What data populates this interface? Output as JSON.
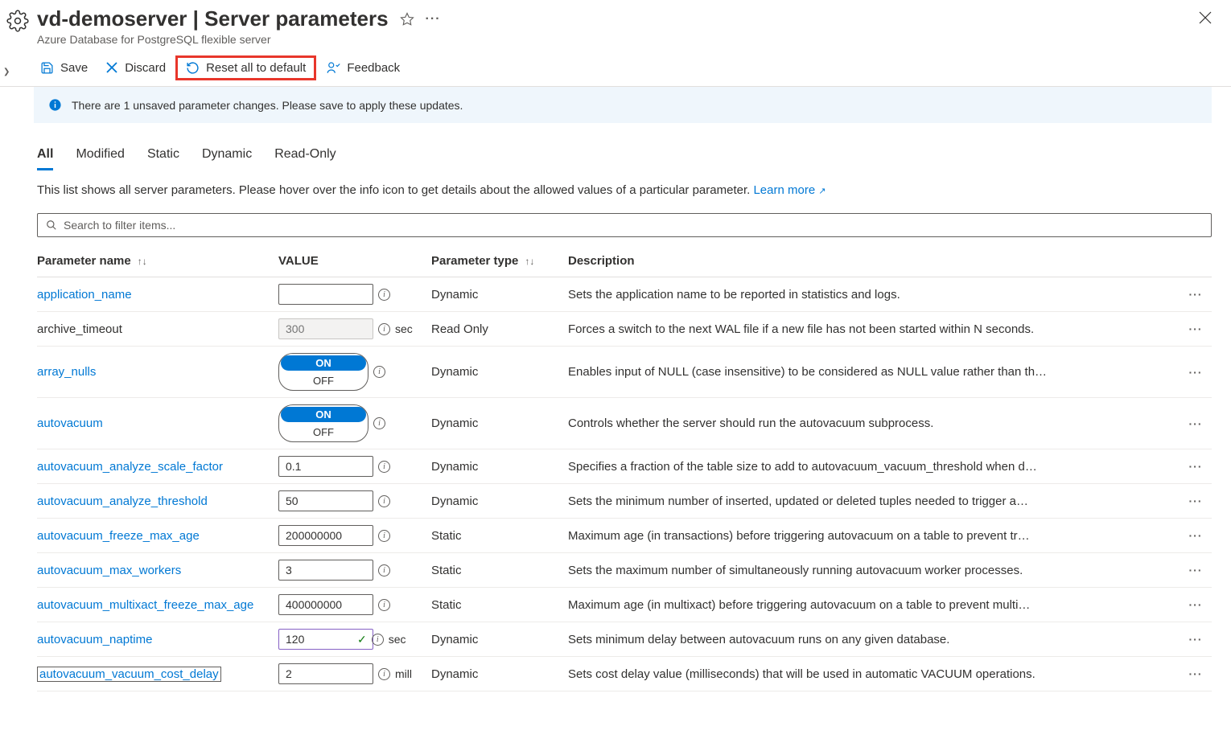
{
  "header": {
    "resource_name": "vd-demoserver",
    "page_title": "Server parameters",
    "breadcrumb": "Azure Database for PostgreSQL flexible server"
  },
  "toolbar": {
    "save": "Save",
    "discard": "Discard",
    "reset": "Reset all to default",
    "feedback": "Feedback"
  },
  "banner": {
    "text": "There are 1 unsaved parameter changes.  Please save to apply these updates."
  },
  "tabs": [
    "All",
    "Modified",
    "Static",
    "Dynamic",
    "Read-Only"
  ],
  "active_tab": 0,
  "description": {
    "text": "This list shows all server parameters. Please hover over the info icon to get details about the allowed values of a particular parameter. ",
    "link": "Learn more"
  },
  "search": {
    "placeholder": "Search to filter items..."
  },
  "columns": {
    "name": "Parameter name",
    "value": "VALUE",
    "type": "Parameter type",
    "desc": "Description"
  },
  "units": {
    "sec": "seconds",
    "mill": "milliseconds"
  },
  "toggle_labels": {
    "on": "ON",
    "off": "OFF"
  },
  "rows": [
    {
      "name": "application_name",
      "link": true,
      "value_kind": "text",
      "value": "",
      "unit": "",
      "type": "Dynamic",
      "desc": "Sets the application name to be reported in statistics and logs."
    },
    {
      "name": "archive_timeout",
      "link": false,
      "value_kind": "text_ro",
      "value": "300",
      "unit": "sec",
      "type": "Read Only",
      "desc": "Forces a switch to the next WAL file if a new file has not been started within N seconds."
    },
    {
      "name": "array_nulls",
      "link": true,
      "value_kind": "toggle",
      "value": "ON",
      "unit": "",
      "type": "Dynamic",
      "desc": "Enables input of NULL (case insensitive) to be considered as NULL value rather than th…"
    },
    {
      "name": "autovacuum",
      "link": true,
      "value_kind": "toggle",
      "value": "ON",
      "unit": "",
      "type": "Dynamic",
      "desc": "Controls whether the server should run the autovacuum subprocess."
    },
    {
      "name": "autovacuum_analyze_scale_factor",
      "link": true,
      "value_kind": "text",
      "value": "0.1",
      "unit": "",
      "type": "Dynamic",
      "desc": "Specifies a fraction of the table size to add to autovacuum_vacuum_threshold when d…"
    },
    {
      "name": "autovacuum_analyze_threshold",
      "link": true,
      "value_kind": "text",
      "value": "50",
      "unit": "",
      "type": "Dynamic",
      "desc": "Sets the minimum number of inserted, updated or deleted tuples needed to trigger a…"
    },
    {
      "name": "autovacuum_freeze_max_age",
      "link": true,
      "value_kind": "text",
      "value": "200000000",
      "unit": "",
      "type": "Static",
      "desc": "Maximum age (in transactions) before triggering autovacuum on a table to prevent tr…"
    },
    {
      "name": "autovacuum_max_workers",
      "link": true,
      "value_kind": "text",
      "value": "3",
      "unit": "",
      "type": "Static",
      "desc": "Sets the maximum number of simultaneously running autovacuum worker processes."
    },
    {
      "name": "autovacuum_multixact_freeze_max_age",
      "link": true,
      "value_kind": "text",
      "value": "400000000",
      "unit": "",
      "type": "Static",
      "desc": "Maximum age (in multixact) before triggering autovacuum on a table to prevent multi…"
    },
    {
      "name": "autovacuum_naptime",
      "link": true,
      "value_kind": "text_changed",
      "value": "120",
      "unit": "sec",
      "type": "Dynamic",
      "desc": "Sets minimum delay between autovacuum runs on any given database."
    },
    {
      "name": "autovacuum_vacuum_cost_delay",
      "link": true,
      "boxed": true,
      "value_kind": "text",
      "value": "2",
      "unit": "mill",
      "type": "Dynamic",
      "desc": "Sets cost delay value (milliseconds) that will be used in automatic VACUUM operations."
    }
  ]
}
